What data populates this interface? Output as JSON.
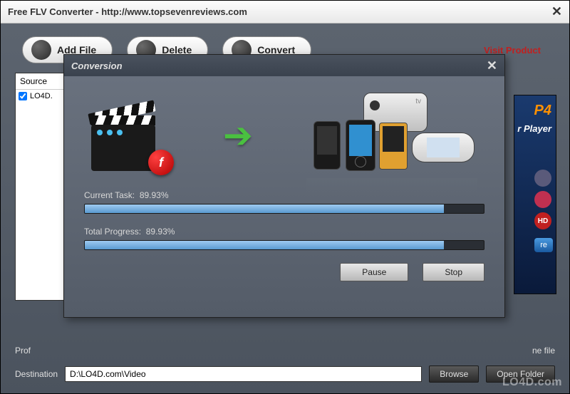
{
  "window": {
    "title": "Free FLV Converter - http://www.topsevenreviews.com"
  },
  "toolbar": {
    "add_file": "Add File",
    "delete": "Delete",
    "convert": "Convert",
    "visit": "Visit Product"
  },
  "source": {
    "header": "Source",
    "item": "LO4D."
  },
  "banner": {
    "p4": "P4",
    "player": "r Player",
    "hd": "HD",
    "more": "re"
  },
  "bottom": {
    "prof_label": "Prof",
    "ne_file": "ne file",
    "dest_label": "Destination",
    "dest_value": "D:\\LO4D.com\\Video",
    "browse": "Browse",
    "open_folder": "Open Folder"
  },
  "dialog": {
    "title": "Conversion",
    "close": "✕",
    "flash_letter": "f",
    "arrow": "➔",
    "current_label": "Current Task:",
    "current_pct": "89.93%",
    "current_fill": 89.93,
    "total_label": "Total Progress:",
    "total_pct": "89.93%",
    "total_fill": 89.93,
    "pause": "Pause",
    "stop": "Stop"
  },
  "watermark": "LO4D.com"
}
